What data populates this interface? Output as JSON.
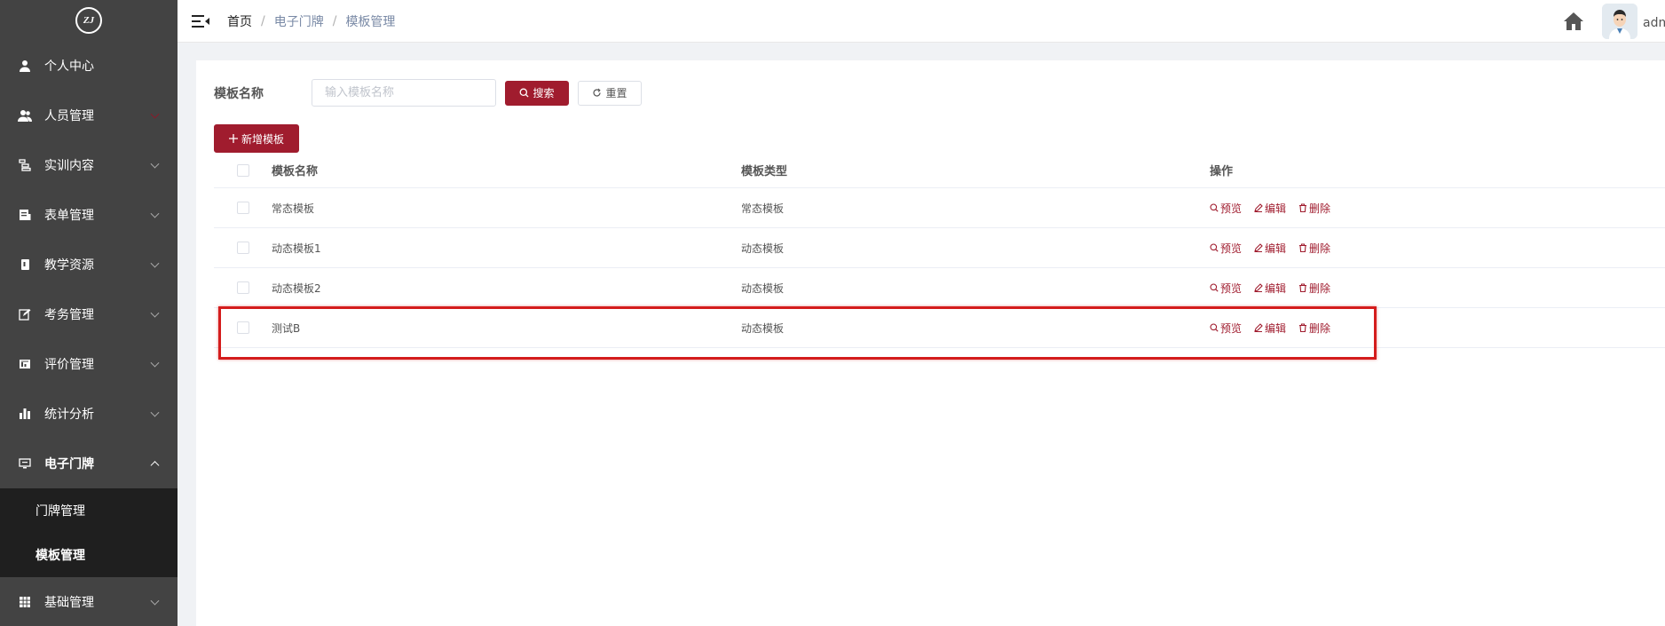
{
  "logo": {
    "text": "ZJ"
  },
  "sidebar": {
    "items": [
      {
        "label": "个人中心",
        "icon": "user-icon"
      },
      {
        "label": "人员管理",
        "icon": "users-icon"
      },
      {
        "label": "实训内容",
        "icon": "list-icon"
      },
      {
        "label": "表单管理",
        "icon": "form-icon"
      },
      {
        "label": "教学资源",
        "icon": "book-icon"
      },
      {
        "label": "考务管理",
        "icon": "edit-icon"
      },
      {
        "label": "评价管理",
        "icon": "chart-card-icon"
      },
      {
        "label": "统计分析",
        "icon": "bar-chart-icon"
      },
      {
        "label": "电子门牌",
        "icon": "monitor-icon"
      }
    ],
    "submenu": [
      {
        "label": "门牌管理"
      },
      {
        "label": "模板管理"
      }
    ],
    "bottom_item": {
      "label": "基础管理",
      "icon": "grid-icon"
    }
  },
  "breadcrumb": {
    "home": "首页",
    "level1": "电子门牌",
    "level2": "模板管理",
    "separator": "/"
  },
  "header": {
    "username": "adm"
  },
  "search": {
    "label": "模板名称",
    "placeholder": "输入模板名称",
    "search_button": "搜索",
    "reset_button": "重置"
  },
  "add_button": "新增模板",
  "table": {
    "columns": {
      "name": "模板名称",
      "type": "模板类型",
      "ops": "操作"
    },
    "rows": [
      {
        "name": "常态模板",
        "type": "常态模板"
      },
      {
        "name": "动态模板1",
        "type": "动态模板"
      },
      {
        "name": "动态模板2",
        "type": "动态模板"
      },
      {
        "name": "测试B",
        "type": "动态模板"
      }
    ],
    "actions": {
      "preview": "预览",
      "edit": "编辑",
      "delete": "删除"
    }
  },
  "colors": {
    "accent": "#a01c2e",
    "sidebar_bg": "#434343",
    "submenu_bg": "#1f1f1f",
    "highlight": "#d41c1c"
  }
}
